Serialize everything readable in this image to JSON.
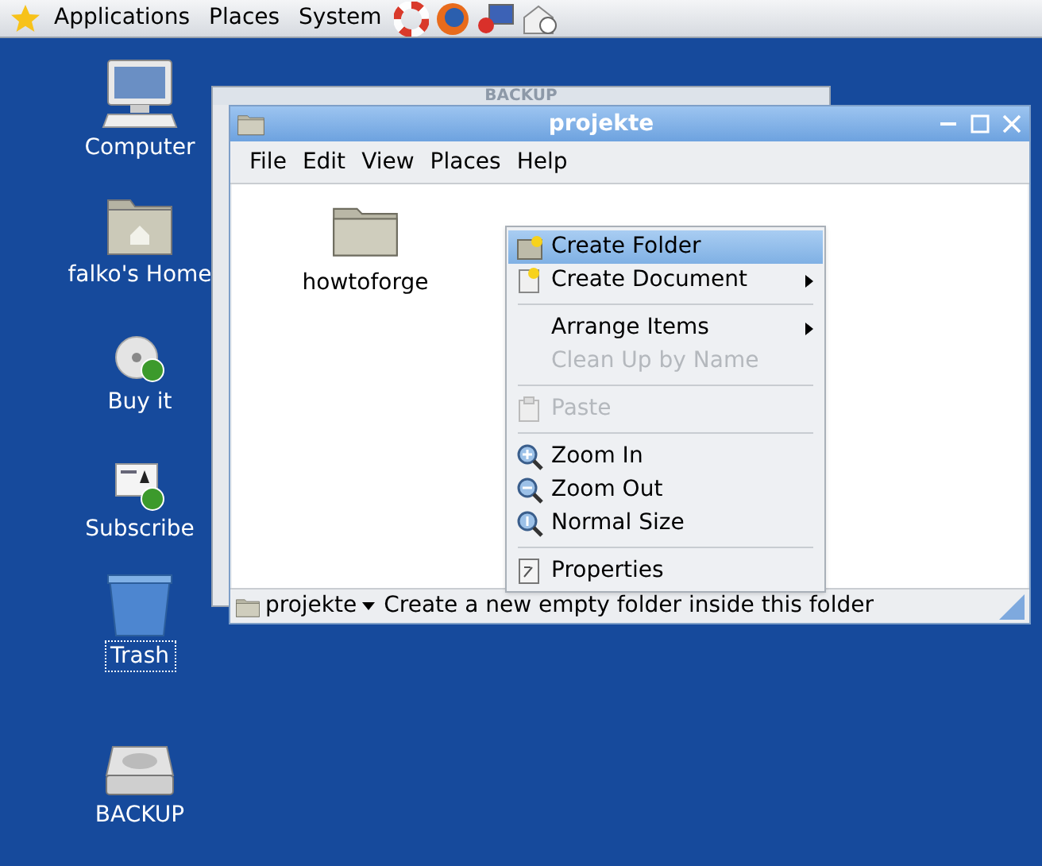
{
  "panel": {
    "menus": [
      "Applications",
      "Places",
      "System"
    ]
  },
  "desktop_icons": [
    {
      "label": "Computer",
      "kind": "computer",
      "selected": false
    },
    {
      "label": "falko's Home",
      "kind": "home",
      "selected": false
    },
    {
      "label": "Buy it",
      "kind": "disc",
      "selected": false
    },
    {
      "label": "Subscribe",
      "kind": "subscribe",
      "selected": false
    },
    {
      "label": "Trash",
      "kind": "trash",
      "selected": true
    },
    {
      "label": "BACKUP",
      "kind": "drive",
      "selected": false
    }
  ],
  "back_window": {
    "title": "BACKUP"
  },
  "window": {
    "title": "projekte",
    "menus": [
      "File",
      "Edit",
      "View",
      "Places",
      "Help"
    ],
    "items": [
      {
        "label": "howtoforge"
      }
    ],
    "context_menu": [
      {
        "kind": "folder",
        "label": "Create Folder",
        "selected": true,
        "disabled": false,
        "submenu": false
      },
      {
        "kind": "document",
        "label": "Create Document",
        "selected": false,
        "disabled": false,
        "submenu": true
      },
      {
        "kind": "separator"
      },
      {
        "kind": "plain",
        "label": "Arrange Items",
        "selected": false,
        "disabled": false,
        "submenu": true
      },
      {
        "kind": "plain",
        "label": "Clean Up by Name",
        "selected": false,
        "disabled": true,
        "submenu": false
      },
      {
        "kind": "separator"
      },
      {
        "kind": "paste",
        "label": "Paste",
        "selected": false,
        "disabled": true,
        "submenu": false
      },
      {
        "kind": "separator"
      },
      {
        "kind": "zoomin",
        "label": "Zoom In",
        "selected": false,
        "disabled": false,
        "submenu": false
      },
      {
        "kind": "zoomout",
        "label": "Zoom Out",
        "selected": false,
        "disabled": false,
        "submenu": false
      },
      {
        "kind": "zoomreset",
        "label": "Normal Size",
        "selected": false,
        "disabled": false,
        "submenu": false
      },
      {
        "kind": "separator"
      },
      {
        "kind": "properties",
        "label": "Properties",
        "selected": false,
        "disabled": false,
        "submenu": false
      }
    ],
    "status_bar": {
      "location": "projekte",
      "message": "Create a new empty folder inside this folder"
    }
  }
}
